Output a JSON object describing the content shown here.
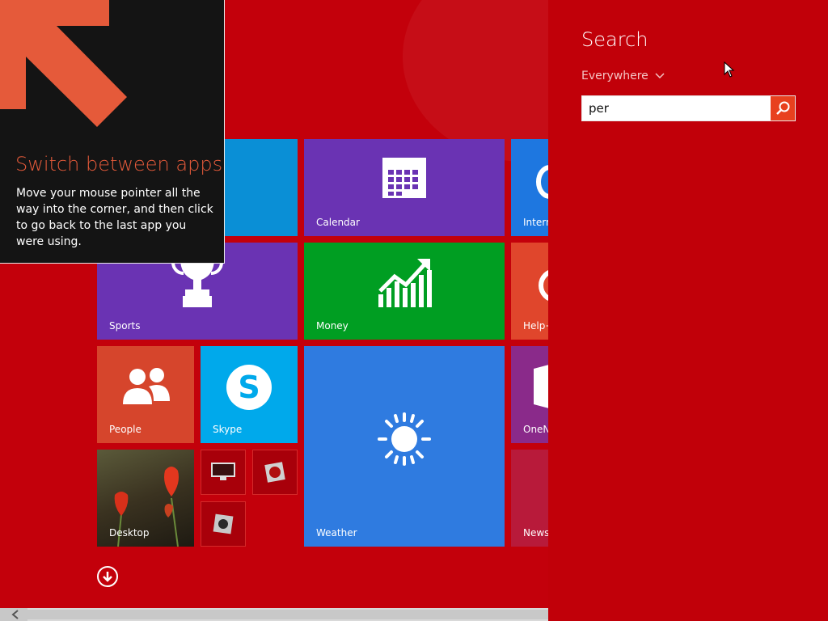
{
  "colors": {
    "start_bg": "#c3000b",
    "charm_bg": "#c10009",
    "tile_purple": "#6a33b3",
    "tile_green": "#009e22",
    "tile_blue": "#2f7be0",
    "tile_skype": "#00a9eb",
    "tile_people": "#d6452c",
    "search_button": "#e8401e",
    "tip_title": "#e55a3a"
  },
  "tip": {
    "title": "Switch between apps",
    "body": "Move your mouse pointer all the way into the corner, and then click to go back to the last app you were using.",
    "icon": "arrow-up-left-icon"
  },
  "tiles": {
    "calendar": {
      "label": "Calendar",
      "icon": "calendar-icon"
    },
    "internet": {
      "label": "Intern",
      "icon": "internet-explorer-icon"
    },
    "sports": {
      "label": "Sports",
      "icon": "trophy-icon"
    },
    "money": {
      "label": "Money",
      "icon": "chart-up-icon"
    },
    "help": {
      "label": "Help+",
      "icon": "help-icon"
    },
    "people": {
      "label": "People",
      "icon": "people-icon"
    },
    "skype": {
      "label": "Skype",
      "icon": "skype-icon"
    },
    "weather": {
      "label": "Weather",
      "icon": "sun-icon"
    },
    "onenote": {
      "label": "OneN",
      "icon": "onenote-icon"
    },
    "desktop": {
      "label": "Desktop",
      "icon": "tulip-wallpaper"
    },
    "news": {
      "label": "News",
      "icon": "news-icon"
    }
  },
  "search": {
    "title": "Search",
    "scope": "Everywhere",
    "query": "per"
  }
}
